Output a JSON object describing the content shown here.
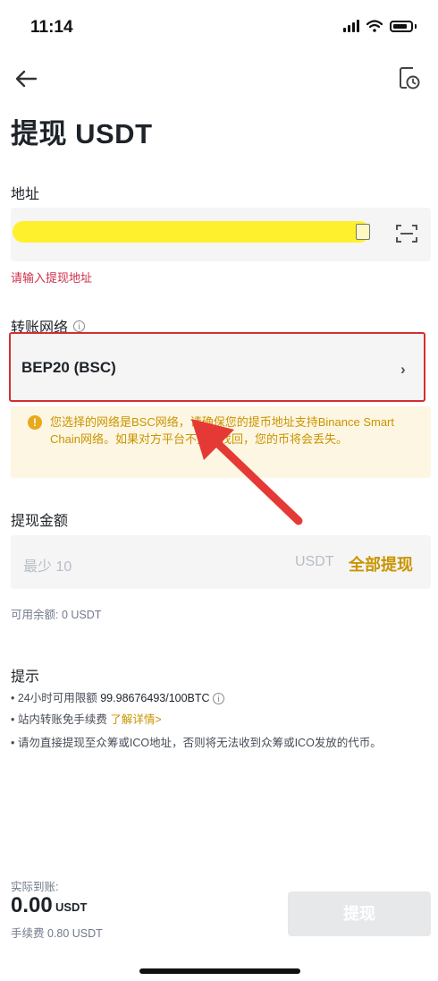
{
  "status_bar": {
    "time": "11:14"
  },
  "header": {
    "title": "提现 USDT"
  },
  "address": {
    "label": "地址",
    "error": "请输入提现地址"
  },
  "network": {
    "label": "转账网络",
    "info_icon": "ⓘ",
    "value": "BEP20 (BSC)",
    "chevron": "›",
    "warning": "您选择的网络是BSC网络，请确保您的提币地址支持Binance Smart Chain网络。如果对方平台不支持找回，您的币将会丢失。"
  },
  "amount": {
    "label": "提现金额",
    "placeholder": "最少 10",
    "unit": "USDT",
    "withdraw_all": "全部提现",
    "balance": "可用余额: 0 USDT"
  },
  "tips": {
    "title": "提示",
    "tip1_prefix": "• 24小时可用限额 ",
    "tip1_value": "99.98676493/100BTC",
    "tip2_prefix": "• 站内转账免手续费 ",
    "tip2_link": "了解详情>",
    "tip3": "• 请勿直接提现至众筹或ICO地址，否则将无法收到众筹或ICO发放的代币。"
  },
  "footer": {
    "received_label": "实际到账:",
    "received_amount": "0.00",
    "received_unit": "USDT",
    "fee": "手续费  0.80 USDT",
    "submit_label": "提现"
  },
  "colors": {
    "accent": "#c99400",
    "error": "#cf304a",
    "highlight_box": "#d32f2f",
    "arrow": "#e53935",
    "warning_bg": "#fdf6e3"
  },
  "icons": [
    "back-arrow-icon",
    "history-icon",
    "paste-icon",
    "scan-icon",
    "info-icon",
    "chevron-right-icon",
    "warning-icon"
  ]
}
